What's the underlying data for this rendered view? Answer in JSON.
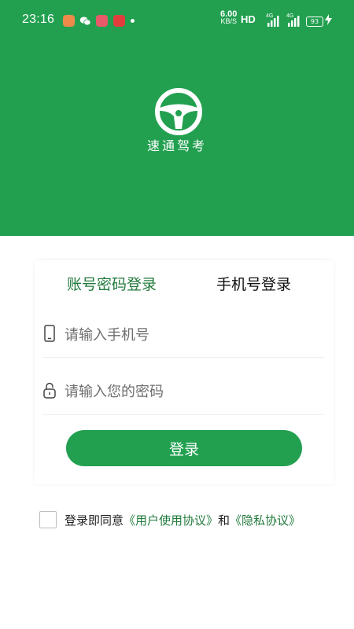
{
  "status_bar": {
    "time": "23:16",
    "net_speed_value": "6.00",
    "net_speed_unit": "KB/S",
    "hd": "HD",
    "signal_1": "4G",
    "signal_2": "4G",
    "battery": "93",
    "app_icons": [
      "app-notification-icon",
      "wechat-icon",
      "video-app-icon",
      "news-app-icon"
    ],
    "app_icon_colors": [
      "#f08a4b",
      "#ffffff",
      "#e85a6a",
      "#e23d3d"
    ]
  },
  "header": {
    "background": "#22a050",
    "logo_icon": "steering-wheel-icon",
    "app_name": "速通驾考"
  },
  "tabs": {
    "account_login": "账号密码登录",
    "phone_login": "手机号登录",
    "active_color": "#217a3c"
  },
  "form": {
    "phone_placeholder": "请输入手机号",
    "phone_value": "",
    "phone_icon": "mobile-phone-icon",
    "password_placeholder": "请输入您的密码",
    "password_value": "",
    "password_icon": "lock-icon",
    "login_button": "登录",
    "button_color": "#22a050"
  },
  "agreement": {
    "checked": false,
    "prefix": "登录即同意",
    "user_agreement": "《用户使用协议》",
    "conjunction": "和",
    "privacy_policy": "《隐私协议》"
  }
}
